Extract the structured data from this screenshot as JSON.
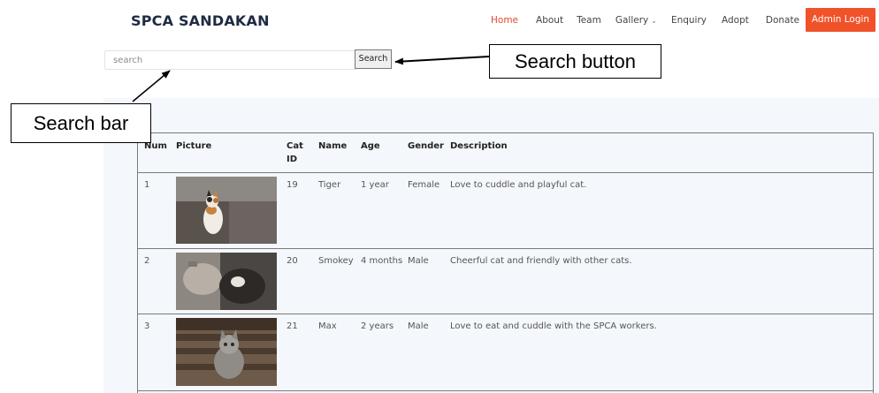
{
  "header": {
    "brand": "SPCA SANDAKAN",
    "nav": [
      {
        "label": "Home",
        "active": true
      },
      {
        "label": "About"
      },
      {
        "label": "Team"
      },
      {
        "label": "Gallery",
        "dropdown": true
      },
      {
        "label": "Enquiry"
      },
      {
        "label": "Adopt"
      },
      {
        "label": "Donate"
      }
    ],
    "admin_label": "Admin Login",
    "accent": "#f05229"
  },
  "search": {
    "placeholder": "search",
    "button_label": "Search"
  },
  "table": {
    "headers": [
      "Num",
      "Picture",
      "Cat ID",
      "Name",
      "Age",
      "Gender",
      "Description"
    ],
    "rows": [
      {
        "num": "1",
        "cat_id": "19",
        "name": "Tiger",
        "age": "1 year",
        "gender": "Female",
        "description": "Love to cuddle and playful cat."
      },
      {
        "num": "2",
        "cat_id": "20",
        "name": "Smokey",
        "age": "4 months",
        "gender": "Male",
        "description": "Cheerful cat and friendly with other cats."
      },
      {
        "num": "3",
        "cat_id": "21",
        "name": "Max",
        "age": "2 years",
        "gender": "Male",
        "description": "Love to eat and cuddle with the SPCA workers."
      }
    ]
  },
  "annotations": {
    "search_bar": "Search bar",
    "search_button": "Search button"
  }
}
